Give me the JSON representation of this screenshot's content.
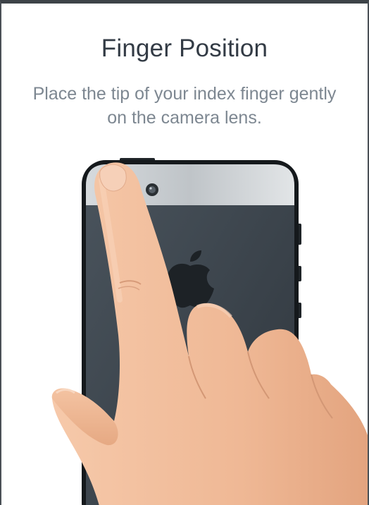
{
  "screen": {
    "title": "Finger Position",
    "instruction": "Place the tip of your index finger gently on the camera lens."
  },
  "illustration": {
    "subject": "hand-on-phone-camera",
    "phone_color": "#3c444c",
    "skin_color": "#f2bd9c"
  },
  "colors": {
    "title": "#333b45",
    "instruction": "#7d8791",
    "background": "#ffffff"
  }
}
